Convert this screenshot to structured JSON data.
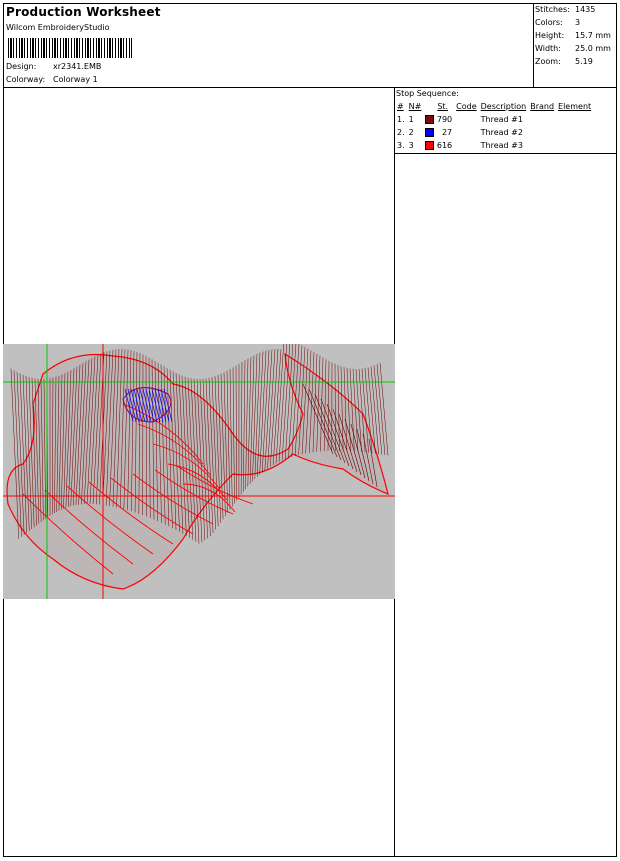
{
  "header": {
    "title": "Production Worksheet",
    "software": "Wilcom EmbroideryStudio",
    "design_label": "Design:",
    "design_value": "xr2341.EMB",
    "colorway_label": "Colorway:",
    "colorway_value": "Colorway 1"
  },
  "stats": [
    {
      "label": "Stitches:",
      "value": "1435"
    },
    {
      "label": "Colors:",
      "value": "3"
    },
    {
      "label": "Height:",
      "value": "15.7 mm"
    },
    {
      "label": "Width:",
      "value": "25.0 mm"
    },
    {
      "label": "Zoom:",
      "value": "5.19"
    }
  ],
  "stop_sequence": {
    "title": "Stop Sequence:",
    "headers": [
      "#",
      "N#",
      "St.",
      "Code",
      "Description",
      "Brand",
      "Element"
    ],
    "rows": [
      {
        "num": "1.",
        "n": "1",
        "color": "#7a0b0b",
        "st": "790",
        "code": "",
        "description": "Thread #1",
        "brand": "",
        "element": ""
      },
      {
        "num": "2.",
        "n": "2",
        "color": "#0000ff",
        "st": "27",
        "code": "",
        "description": "Thread #2",
        "brand": "",
        "element": ""
      },
      {
        "num": "3.",
        "n": "3",
        "color": "#ff0000",
        "st": "616",
        "code": "",
        "description": "Thread #3",
        "brand": "",
        "element": ""
      }
    ]
  },
  "canvas": {
    "background": "#c0c0c0",
    "guide_color": "#00cc00",
    "stitch_dark": "#6a0000",
    "stitch_red": "#ff0000",
    "stitch_blue": "#0000ff"
  }
}
